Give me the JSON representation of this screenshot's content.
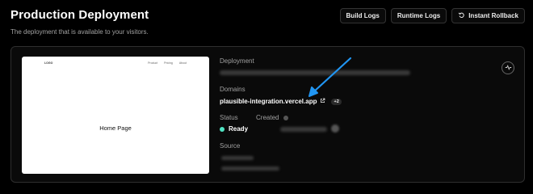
{
  "header": {
    "title": "Production Deployment",
    "subtitle": "The deployment that is available to your visitors."
  },
  "toolbar": {
    "build_logs": "Build Logs",
    "runtime_logs": "Runtime Logs",
    "instant_rollback": "Instant Rollback"
  },
  "preview": {
    "logo": "LOGO",
    "nav": [
      "Product",
      "Pricing",
      "About"
    ],
    "home_label": "Home Page"
  },
  "details": {
    "deployment_label": "Deployment",
    "domains_label": "Domains",
    "domain": "plausible-integration.vercel.app",
    "domain_extra": "+2",
    "status_label": "Status",
    "status_value": "Ready",
    "created_label": "Created",
    "source_label": "Source"
  },
  "colors": {
    "status_ready": "#50e3c2",
    "annotation_arrow": "#2196f3"
  },
  "icons": {
    "rollback": "rollback-icon",
    "external_link": "external-link-icon",
    "activity": "activity-icon",
    "info": "info-icon"
  }
}
